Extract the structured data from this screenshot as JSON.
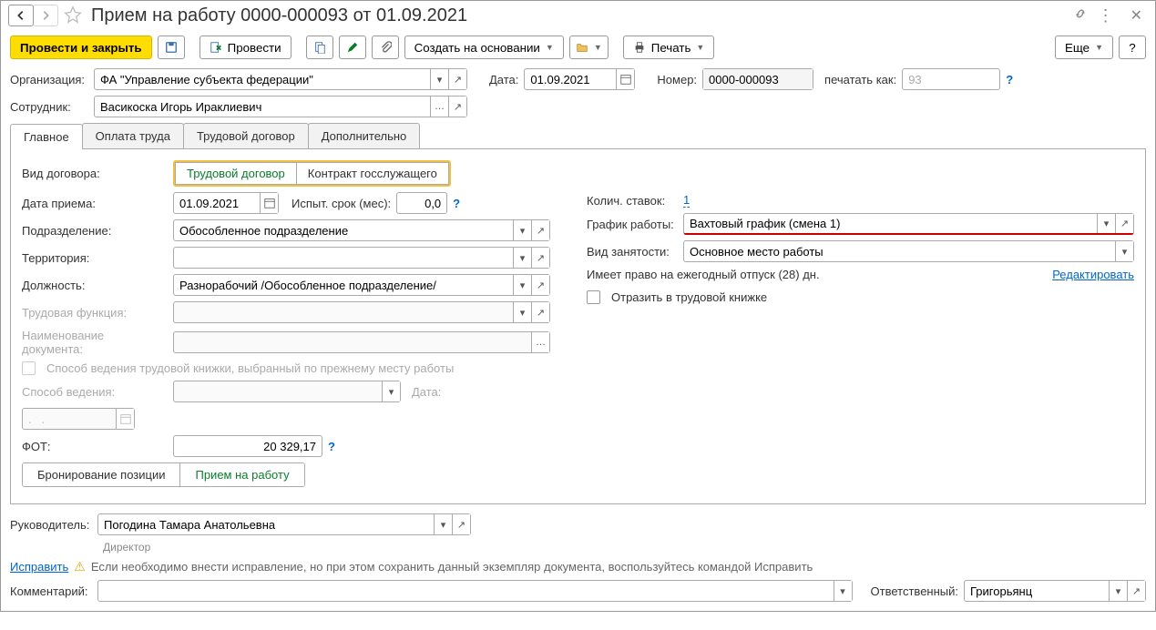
{
  "title": "Прием на работу 0000-000093 от 01.09.2021",
  "toolbar": {
    "post_close": "Провести и закрыть",
    "post": "Провести",
    "create_based": "Создать на основании",
    "print": "Печать",
    "more": "Еще"
  },
  "header": {
    "org_label": "Организация:",
    "org_value": "ФА \"Управление субъекта федерации\"",
    "date_label": "Дата:",
    "date_value": "01.09.2021",
    "number_label": "Номер:",
    "number_value": "0000-000093",
    "print_as_label": "печатать как:",
    "print_as_value": "93",
    "employee_label": "Сотрудник:",
    "employee_value": "Васикоска Игорь Ираклиевич"
  },
  "tabs": {
    "main": "Главное",
    "payment": "Оплата труда",
    "work_contract": "Трудовой договор",
    "additional": "Дополнительно"
  },
  "mainTab": {
    "contract_type_label": "Вид договора:",
    "contract_work": "Трудовой договор",
    "contract_gov": "Контракт госслужащего",
    "hire_date_label": "Дата приема:",
    "hire_date_value": "01.09.2021",
    "probation_label": "Испыт. срок (мес):",
    "probation_value": "0,0",
    "department_label": "Подразделение:",
    "department_value": "Обособленное подразделение",
    "territory_label": "Территория:",
    "territory_value": "",
    "position_label": "Должность:",
    "position_value": "Разнорабочий /Обособленное подразделение/",
    "work_function_label": "Трудовая функция:",
    "doc_name_label": "Наименование документа:",
    "workbook_method_check": "Способ ведения трудовой книжки, выбранный по прежнему месту работы",
    "method_label": "Способ ведения:",
    "method_date_label": "Дата:",
    "method_date_value": ".   .",
    "fot_label": "ФОТ:",
    "fot_value": "20 329,17",
    "booking": "Бронирование позиции",
    "hiring": "Прием на работу",
    "rates_label": "Колич. ставок:",
    "rates_value": "1",
    "schedule_label": "График работы:",
    "schedule_value": "Вахтовый график (смена 1)",
    "employment_label": "Вид занятости:",
    "employment_value": "Основное место работы",
    "vacation_text": "Имеет право на ежегодный отпуск (28) дн.",
    "edit": "Редактировать",
    "workbook_reflect": "Отразить в трудовой книжке"
  },
  "footer": {
    "manager_label": "Руководитель:",
    "manager_value": "Погодина Тамара Анатольевна",
    "manager_role": "Директор",
    "correct": "Исправить",
    "correct_text": "Если необходимо внести исправление, но при этом сохранить данный экземпляр документа, воспользуйтесь командой Исправить",
    "comment_label": "Комментарий:",
    "responsible_label": "Ответственный:",
    "responsible_value": "Григорьянц"
  }
}
